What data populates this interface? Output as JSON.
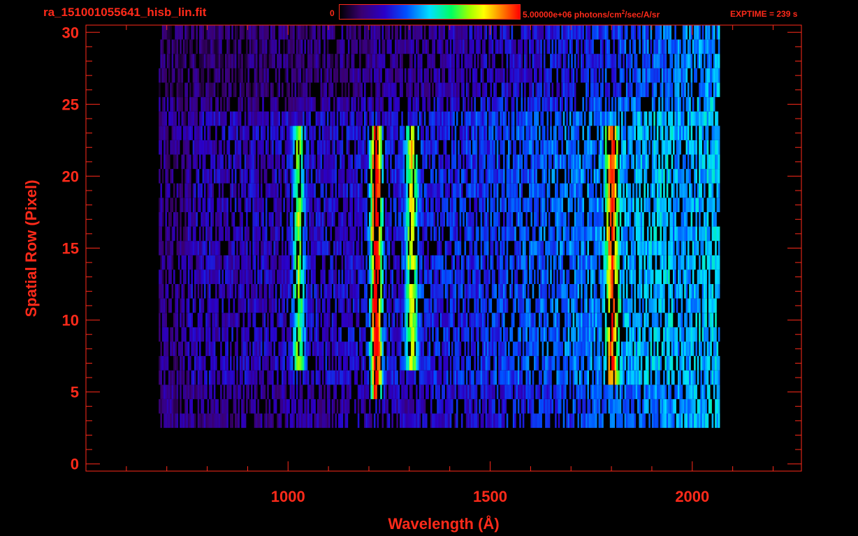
{
  "header": {
    "filename": "ra_151001055641_hisb_lin.fit",
    "colorbar_min": "0",
    "colorbar_max_value": "5.00000e+06 photons/cm",
    "colorbar_max_exp": "2",
    "colorbar_max_unit": "/sec/A/sr",
    "exptime": "EXPTIME = 239 s"
  },
  "chart_data": {
    "type": "heatmap",
    "title": "ra_151001055641_hisb_lin.fit",
    "xlabel": "Wavelength (Å)",
    "ylabel": "Spatial Row (Pixel)",
    "xlim": [
      500,
      2270
    ],
    "ylim": [
      -0.5,
      30.5
    ],
    "x_ticks": [
      1000,
      1500,
      2000
    ],
    "y_ticks": [
      0,
      5,
      10,
      15,
      20,
      25,
      30
    ],
    "colorbar": {
      "min": 0,
      "max": 5000000,
      "units": "photons/cm^2/sec/A/sr",
      "colormap": "rainbow"
    },
    "data_extent": {
      "x": [
        680,
        2065
      ],
      "rows": [
        3,
        30
      ]
    },
    "emission_features": [
      {
        "wavelength": 1025,
        "rows": [
          7,
          23
        ],
        "relative_intensity": 0.45
      },
      {
        "wavelength": 1216,
        "rows": [
          5,
          23
        ],
        "relative_intensity": 0.8
      },
      {
        "wavelength": 1304,
        "rows": [
          7,
          23
        ],
        "relative_intensity": 0.5
      },
      {
        "wavelength": 1800,
        "rows": [
          6,
          23
        ],
        "relative_intensity": 0.55
      }
    ],
    "grid": false
  },
  "colors": {
    "axis": "#ff2a1a",
    "background": "#000000"
  }
}
